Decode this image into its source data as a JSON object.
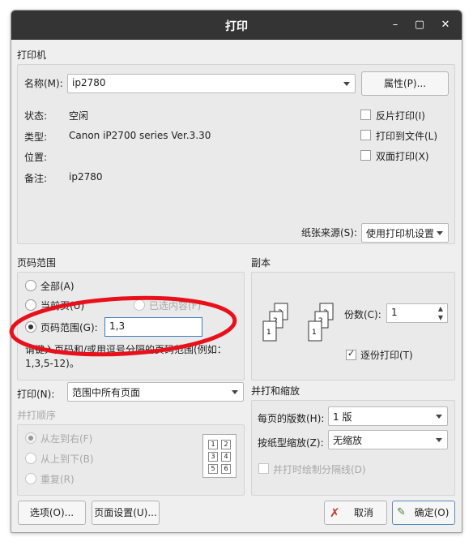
{
  "window": {
    "title": "打印",
    "controls": [
      "–",
      "▢",
      "✕"
    ]
  },
  "printer": {
    "section": "打印机",
    "name_label": "名称(M):",
    "name_value": "ip2780",
    "properties_button": "属性(P)...",
    "status_label": "状态:",
    "status_value": "空闲",
    "type_label": "类型:",
    "type_value": "Canon iP2700 series Ver.3.30",
    "location_label": "位置:",
    "location_value": "",
    "comment_label": "备注:",
    "comment_value": "ip2780",
    "options": [
      "反片打印(I)",
      "打印到文件(L)",
      "双面打印(X)"
    ],
    "paper_source_label": "纸张来源(S):",
    "paper_source_value": "使用打印机设置"
  },
  "page_range": {
    "section": "页码范围",
    "all": "全部(A)",
    "current": "当前页(U)",
    "selection": "已选内容(F)",
    "pages": "页码范围(G):",
    "pages_value": "1,3",
    "hint_line1": "请键入页码和/或用逗号分隔的页码范围(例如：",
    "hint_line2": "1,3,5-12)。"
  },
  "copies": {
    "section": "副本",
    "count_label": "份数(C):",
    "count_value": "1",
    "collate_label": "逐份打印(T)",
    "collate_checked": true
  },
  "print_what": {
    "label": "打印(N):",
    "value": "范围中所有页面"
  },
  "order": {
    "section": "并打顺序",
    "options": [
      "从左到右(F)",
      "从上到下(B)",
      "重复(R)"
    ],
    "page_numbers": [
      "1",
      "2",
      "3",
      "4",
      "5",
      "6"
    ]
  },
  "nup": {
    "section": "并打和缩放",
    "pages_per_sheet_label": "每页的版数(H):",
    "pages_per_sheet_value": "1 版",
    "scale_label": "按纸型缩放(Z):",
    "scale_value": "无缩放",
    "border_label": "并打时绘制分隔线(D)"
  },
  "buttons": {
    "options": "选项(O)...",
    "page_setup": "页面设置(U)...",
    "cancel": "取消",
    "ok": "确定(O)"
  },
  "annotation": {
    "color": "#e8101a"
  }
}
